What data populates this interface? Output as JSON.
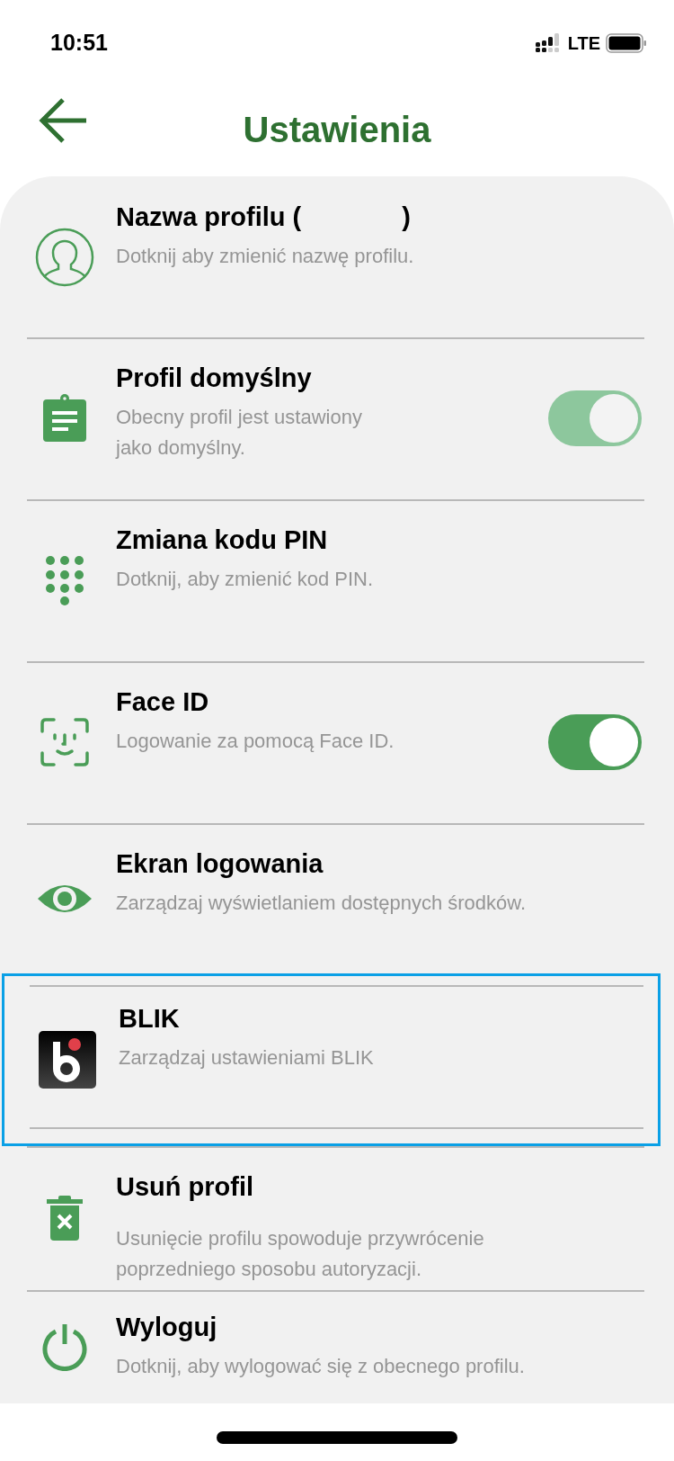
{
  "status_bar": {
    "time": "10:51",
    "network": "LTE"
  },
  "header": {
    "title": "Ustawienia"
  },
  "settings": [
    {
      "title": "Nazwa profilu (",
      "title_suffix": ")",
      "subtitle": "Dotknij aby zmienić nazwę profilu."
    },
    {
      "title": "Profil domyślny",
      "subtitle": "Obecny profil jest ustawiony\njako domyślny.",
      "toggle": {
        "on": true,
        "disabled": true
      }
    },
    {
      "title": "Zmiana kodu PIN",
      "subtitle": "Dotknij, aby zmienić kod PIN."
    },
    {
      "title": "Face ID",
      "subtitle": "Logowanie za pomocą Face ID.",
      "toggle": {
        "on": true,
        "disabled": false
      }
    },
    {
      "title": "Ekran logowania",
      "subtitle": "Zarządzaj wyświetlaniem dostępnych środków."
    },
    {
      "title": "BLIK",
      "subtitle": "Zarządzaj ustawieniami BLIK",
      "highlighted": true
    },
    {
      "title": "Usuń profil",
      "subtitle": "Usunięcie profilu spowoduje przywrócenie\npoprzedniego sposobu autoryzacji."
    },
    {
      "title": "Wyloguj",
      "subtitle": "Dotknij, aby wylogować się z obecnego profilu."
    }
  ]
}
